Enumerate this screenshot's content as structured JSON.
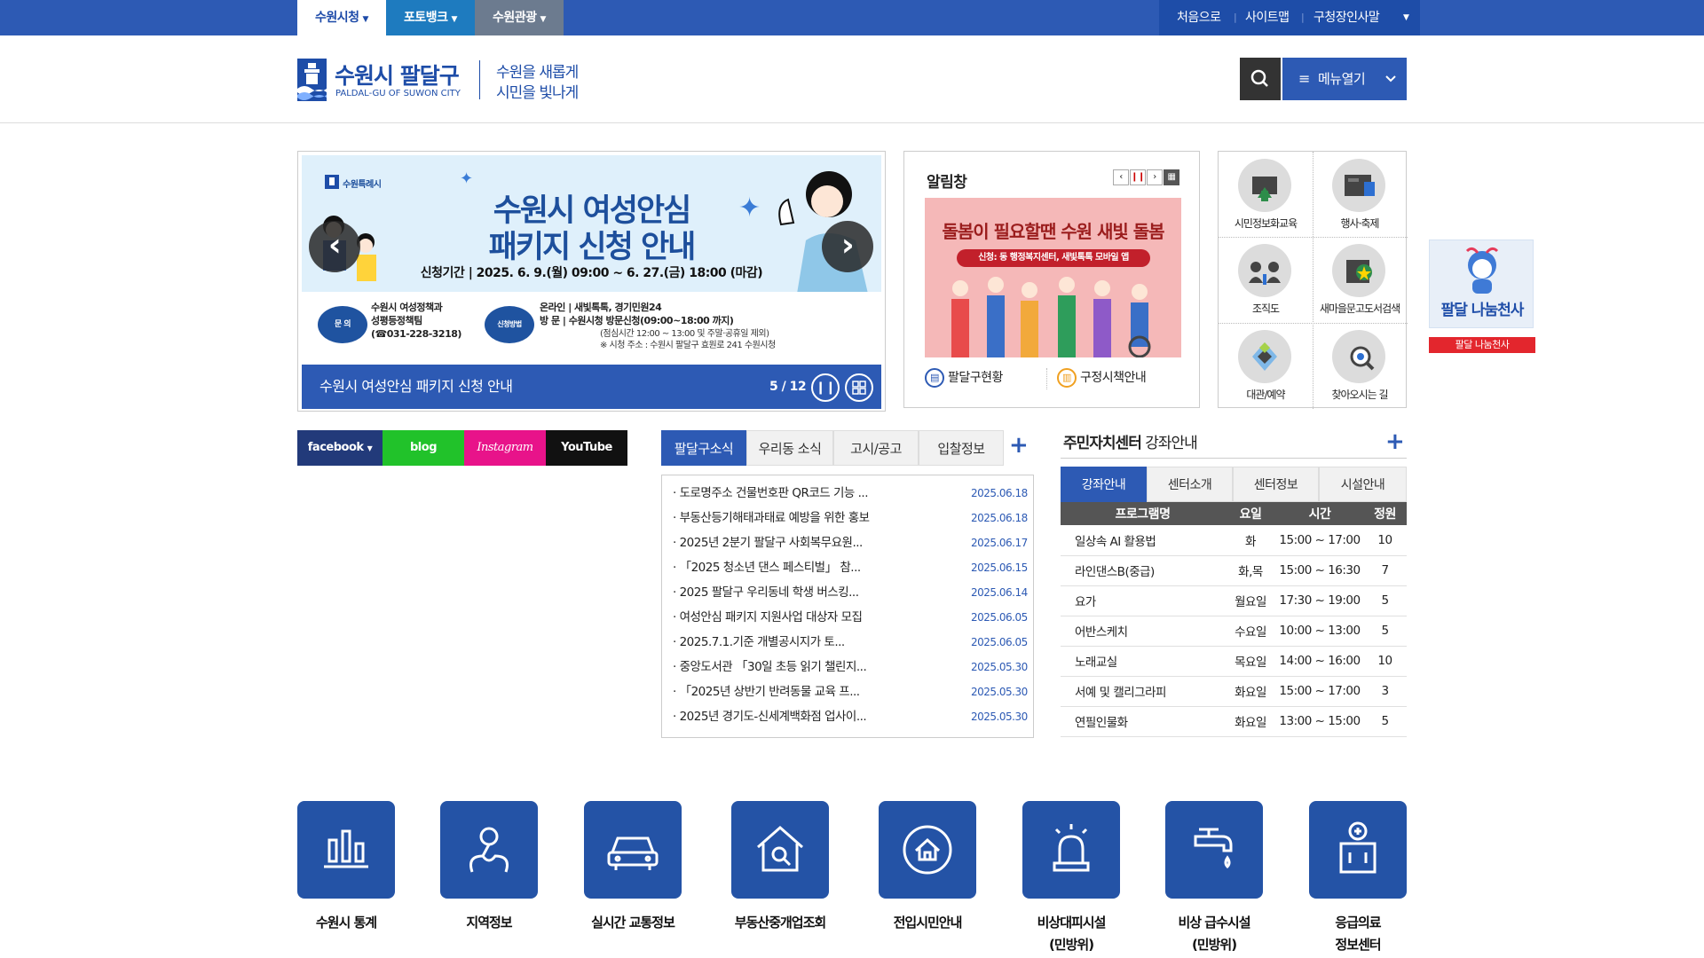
{
  "topbar": {
    "tabs": [
      "수원시청",
      "포토뱅크",
      "수원관광"
    ],
    "util": [
      "처음으로",
      "사이트맵",
      "구청장인사말"
    ]
  },
  "header": {
    "logo_title": "수원시 팔달구",
    "logo_sub": "PALDAL-GU OF SUWON CITY",
    "slogan_1": "수원을 새롭게",
    "slogan_2": "시민을 빛나게",
    "menu_label": "메뉴열기"
  },
  "slider": {
    "brand": "수원특례시",
    "headline_1": "수원시 여성안심",
    "headline_2": "패키지 신청 안내",
    "period": "신청기간 | 2025. 6. 9.(월) 09:00 ~ 6. 27.(금) 18:00 (마감)",
    "contact_badge": "문 의",
    "contact_1": "수원시 여성정책과",
    "contact_2": "성평등정책팀",
    "contact_3": "(☎031-228-3218)",
    "method_badge": "신청방법",
    "online": "온라인 | 새빛톡톡, 경기민원24",
    "visit": "방 문 | 수원시청 방문신청(09:00~18:00 까지)",
    "visit_note1": "(점심시간 12:00 ~ 13:00 및 주말·공휴일 제외)",
    "visit_note2": "※ 시청 주소 : 수원시 팔달구 효원로 241 수원시청",
    "caption": "수원시 여성안심 패키지 신청 안내",
    "counter": "5 / 12"
  },
  "alarm": {
    "title": "알림창",
    "banner_title": "돌봄이 필요할땐 수원 새빛 돌봄",
    "banner_pill": "신청: 동 행정복지센터, 새빛톡톡 모바일 앱",
    "link_1": "팔달구현황",
    "link_2": "구정시책안내"
  },
  "quick": [
    "시민정보화교육",
    "행사·축제",
    "조직도",
    "새마을문고도서검색",
    "대관/예약",
    "찾아오시는 길"
  ],
  "angel": {
    "name": "팔달 나눔천사",
    "label": "팔달 나눔천사"
  },
  "sns": [
    "facebook",
    "blog",
    "Instagram",
    "YouTube"
  ],
  "news": {
    "tabs": [
      "팔달구소식",
      "우리동 소식",
      "고시/공고",
      "입찰정보"
    ],
    "items": [
      {
        "title": "· 도로명주소 건물번호판 QR코드 기능 ...",
        "date": "2025.06.18"
      },
      {
        "title": "· 부동산등기해태과태료 예방을 위한 홍보",
        "date": "2025.06.18"
      },
      {
        "title": "· 2025년 2분기 팔달구 사회복무요원...",
        "date": "2025.06.17"
      },
      {
        "title": "· 「2025 청소년 댄스 페스티벌」 참...",
        "date": "2025.06.15"
      },
      {
        "title": "· 2025 팔달구 우리동네 학생 버스킹...",
        "date": "2025.06.14"
      },
      {
        "title": "· 여성안심 패키지 지원사업 대상자 모집",
        "date": "2025.06.05"
      },
      {
        "title": "· 2025.7.1.기준 개별공시지가 토...",
        "date": "2025.06.05"
      },
      {
        "title": "· 중앙도서관 「30일 초등 읽기 챌린지...",
        "date": "2025.05.30"
      },
      {
        "title": "· 「2025년 상반기 반려동물 교육 프...",
        "date": "2025.05.30"
      },
      {
        "title": "· 2025년 경기도-신세계백화점 업사이...",
        "date": "2025.05.30"
      }
    ]
  },
  "center": {
    "title_bold": "주민자치센터",
    "title_rest": " 강좌안내",
    "tabs": [
      "강좌안내",
      "센터소개",
      "센터정보",
      "시설안내"
    ],
    "headers": [
      "프로그램명",
      "요일",
      "시간",
      "정원"
    ],
    "rows": [
      [
        "일상속 AI 활용법",
        "화",
        "15:00 ~ 17:00",
        "10"
      ],
      [
        "라인댄스B(중급)",
        "화,목",
        "15:00 ~ 16:30",
        "7"
      ],
      [
        "요가",
        "월요일",
        "17:30 ~ 19:00",
        "5"
      ],
      [
        "어반스케치",
        "수요일",
        "10:00 ~ 13:00",
        "5"
      ],
      [
        "노래교실",
        "목요일",
        "14:00 ~ 16:00",
        "10"
      ],
      [
        "서예 및 캘리그라피",
        "화요일",
        "15:00 ~ 17:00",
        "3"
      ],
      [
        "연필인물화",
        "화요일",
        "13:00 ~ 15:00",
        "5"
      ]
    ]
  },
  "services": [
    {
      "label1": "수원시 통계",
      "label2": "",
      "icon": "bar-chart-icon"
    },
    {
      "label1": "지역정보",
      "label2": "",
      "icon": "map-pin-icon"
    },
    {
      "label1": "실시간 교통정보",
      "label2": "",
      "icon": "car-icon"
    },
    {
      "label1": "부동산중개업조회",
      "label2": "",
      "icon": "house-search-icon"
    },
    {
      "label1": "전입시민안내",
      "label2": "",
      "icon": "home-move-icon"
    },
    {
      "label1": "비상대피시설",
      "label2": "(민방위)",
      "icon": "siren-icon"
    },
    {
      "label1": "비상 급수시설",
      "label2": "(민방위)",
      "icon": "faucet-icon"
    },
    {
      "label1": "응급의료",
      "label2": "정보센터",
      "icon": "hospital-icon"
    }
  ],
  "colors": {
    "primary": "#2d5ab4",
    "dark_bar": "#1e4da8",
    "facebook": "#223a7a",
    "blog": "#21c22a",
    "instagram": "#e8138a",
    "youtube": "#111111",
    "service_tile": "#2453a6"
  }
}
